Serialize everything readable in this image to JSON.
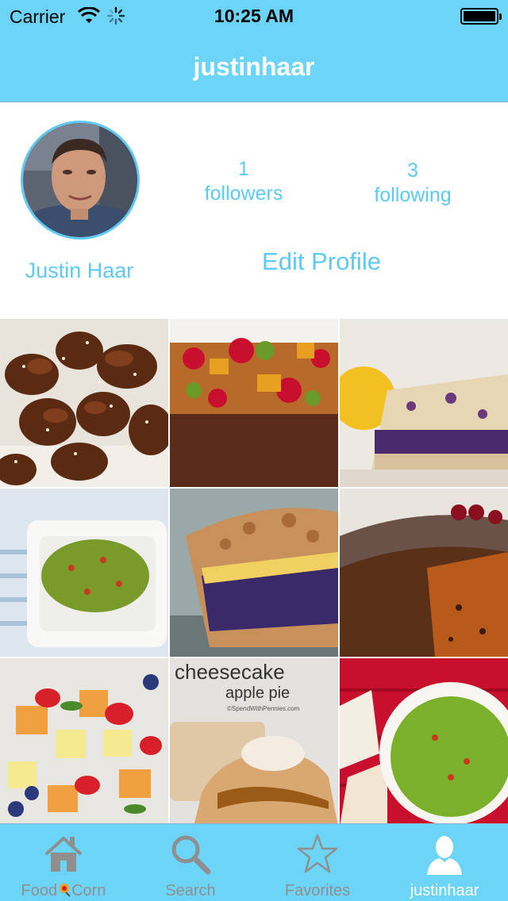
{
  "status_bar": {
    "carrier": "Carrier",
    "time": "10:25 AM"
  },
  "nav": {
    "title": "justinhaar"
  },
  "profile": {
    "name": "Justin Haar",
    "followers_count": "1",
    "followers_label": "followers",
    "following_count": "3",
    "following_label": "following",
    "edit_label": "Edit Profile"
  },
  "grid": {
    "items": [
      {
        "icon": "sesame-chicken-photo"
      },
      {
        "icon": "fruitcake-photo"
      },
      {
        "icon": "berry-bars-photo"
      },
      {
        "icon": "guacamole-photo"
      },
      {
        "icon": "blueberry-pie-photo"
      },
      {
        "icon": "pumpkin-cake-photo"
      },
      {
        "icon": "fruit-salad-photo"
      },
      {
        "icon": "apple-pie-photo",
        "title": "cheesecake",
        "subtitle": "apple pie",
        "credit": "©SpendWithPennies.com"
      },
      {
        "icon": "guacamole-bowl-photo"
      }
    ]
  },
  "tabbar": {
    "tabs": [
      {
        "label_part1": "Food",
        "label_part2": "Corn",
        "icon": "home-icon"
      },
      {
        "label": "Search",
        "icon": "search-icon"
      },
      {
        "label": "Favorites",
        "icon": "star-icon"
      },
      {
        "label": "justinhaar",
        "icon": "person-icon"
      }
    ]
  },
  "colors": {
    "accent": "#6cd4f7",
    "text_accent": "#5ccaf2",
    "tab_inactive": "#8f8f8f",
    "tab_active": "#ffffff"
  }
}
